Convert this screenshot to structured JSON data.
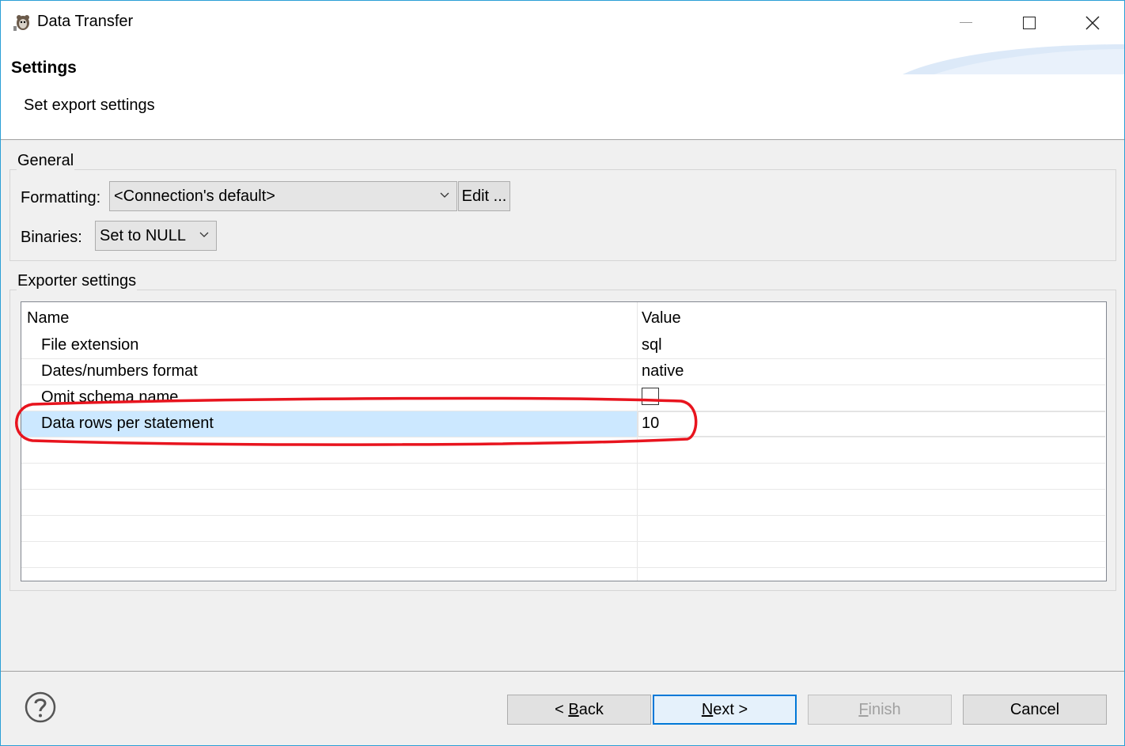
{
  "window": {
    "title": "Data Transfer",
    "accent_color": "#2b9fd6"
  },
  "header": {
    "title": "Settings",
    "description": "Set export settings"
  },
  "general": {
    "legend": "General",
    "formatting_label": "Formatting:",
    "formatting_value": "<Connection's default>",
    "edit_button": "Edit ...",
    "binaries_label": "Binaries:",
    "binaries_value": "Set to NULL"
  },
  "exporter": {
    "legend": "Exporter settings",
    "columns": [
      "Name",
      "Value"
    ],
    "rows": [
      {
        "name": "File extension",
        "value": "sql"
      },
      {
        "name": "Dates/numbers format",
        "value": "native"
      },
      {
        "name": "Omit schema name",
        "value": "",
        "checkbox": true,
        "checked": false
      },
      {
        "name": "Data rows per statement",
        "value": "10",
        "selected": true
      }
    ],
    "selection_color": "#cce8ff",
    "annotation_color": "#e8141e"
  },
  "footer": {
    "back_prefix": "< ",
    "back_mnemonic": "B",
    "back_rest": "ack",
    "next_mnemonic": "N",
    "next_rest": "ext >",
    "finish_mnemonic": "F",
    "finish_rest": "inish",
    "cancel": "Cancel"
  }
}
